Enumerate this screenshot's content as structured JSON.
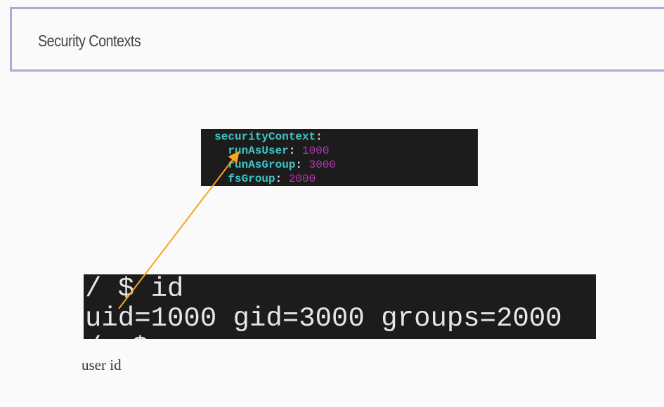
{
  "slide": {
    "title": "Security Contexts",
    "caption": "user id"
  },
  "yaml": {
    "root_key": "securityContext",
    "entries": [
      {
        "key": "runAsUser",
        "value": "1000"
      },
      {
        "key": "runAsGroup",
        "value": "3000"
      },
      {
        "key": "fsGroup",
        "value": "2000"
      }
    ]
  },
  "terminal": {
    "prompt_line": "/ $ id",
    "output_line": "uid=1000 gid=3000 groups=2000",
    "partial_line": "/ $"
  },
  "colors": {
    "accent_border": "#b1a7d6",
    "yaml_key": "#3fc5c6",
    "yaml_value": "#b53ab0",
    "arrow": "#f5a623",
    "code_bg": "#1c1c1c"
  }
}
